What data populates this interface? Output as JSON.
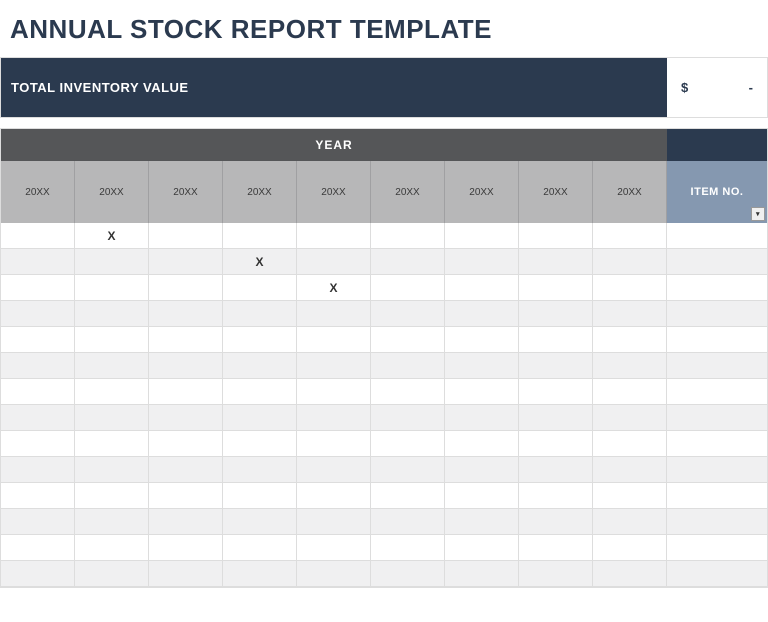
{
  "title": "ANNUAL STOCK REPORT TEMPLATE",
  "inventory": {
    "label": "TOTAL INVENTORY VALUE",
    "currency": "$",
    "value": "-"
  },
  "yearHeader": "YEAR",
  "itemNoHeader": "ITEM NO.",
  "years": [
    "20XX",
    "20XX",
    "20XX",
    "20XX",
    "20XX",
    "20XX",
    "20XX",
    "20XX",
    "20XX"
  ],
  "rows": [
    [
      "",
      "X",
      "",
      "",
      "",
      "",
      "",
      "",
      "",
      ""
    ],
    [
      "",
      "",
      "",
      "X",
      "",
      "",
      "",
      "",
      "",
      ""
    ],
    [
      "",
      "",
      "",
      "",
      "X",
      "",
      "",
      "",
      "",
      ""
    ],
    [
      "",
      "",
      "",
      "",
      "",
      "",
      "",
      "",
      "",
      ""
    ],
    [
      "",
      "",
      "",
      "",
      "",
      "",
      "",
      "",
      "",
      ""
    ],
    [
      "",
      "",
      "",
      "",
      "",
      "",
      "",
      "",
      "",
      ""
    ],
    [
      "",
      "",
      "",
      "",
      "",
      "",
      "",
      "",
      "",
      ""
    ],
    [
      "",
      "",
      "",
      "",
      "",
      "",
      "",
      "",
      "",
      ""
    ],
    [
      "",
      "",
      "",
      "",
      "",
      "",
      "",
      "",
      "",
      ""
    ],
    [
      "",
      "",
      "",
      "",
      "",
      "",
      "",
      "",
      "",
      ""
    ],
    [
      "",
      "",
      "",
      "",
      "",
      "",
      "",
      "",
      "",
      ""
    ],
    [
      "",
      "",
      "",
      "",
      "",
      "",
      "",
      "",
      "",
      ""
    ],
    [
      "",
      "",
      "",
      "",
      "",
      "",
      "",
      "",
      "",
      ""
    ],
    [
      "",
      "",
      "",
      "",
      "",
      "",
      "",
      "",
      "",
      ""
    ]
  ]
}
